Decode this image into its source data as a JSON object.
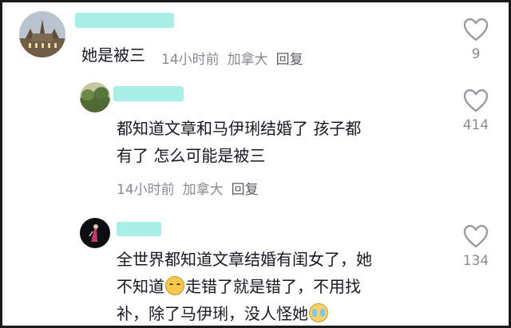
{
  "comments": [
    {
      "text": "她是被三",
      "time": "14小时前",
      "location": "加拿大",
      "reply_label": "回复",
      "likes": "9",
      "avatar_icon": "building-avatar-icon"
    },
    {
      "text_line1": "都知道文章和马伊琍结婚了 孩子都",
      "text_line2": "有了 怎么可能是被三",
      "time": "14小时前",
      "location": "加拿大",
      "reply_label": "回复",
      "likes": "414",
      "avatar_icon": "landscape-avatar-icon"
    },
    {
      "text_line1": "全世界都知道文章结婚有闺女了，她",
      "text_line2a": "不知道",
      "text_line2b": "走错了就是错了，不用找",
      "text_line3": "补，除了马伊琍，没人怪她",
      "likes": "134",
      "avatar_icon": "figure-avatar-icon",
      "emoji1": "sly-face-emoji",
      "emoji2": "crying-face-emoji"
    }
  ],
  "colors": {
    "text": "#161823",
    "meta": "#8a8b91",
    "name_redaction": "#a8efe7",
    "heart": "#9a9ba1"
  },
  "icons": {
    "like": "heart-outline-icon"
  }
}
